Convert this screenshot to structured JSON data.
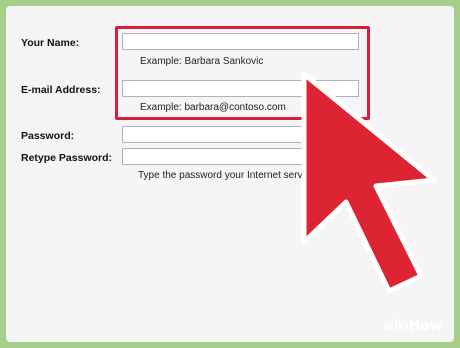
{
  "form": {
    "name_label": "Your Name:",
    "name_value": "",
    "name_example": "Example: Barbara Sankovic",
    "email_label": "E-mail Address:",
    "email_value": "",
    "email_example": "Example: barbara@contoso.com",
    "password_label": "Password:",
    "retype_label": "Retype Password:",
    "password_hint": "Type the password your Internet serv"
  },
  "overlay": {
    "logo_part1": "wiki",
    "logo_part2": "How",
    "highlight_color": "#d81e36",
    "cursor_color": "#dc2433",
    "cursor_icon": "arrow-cursor-icon"
  }
}
